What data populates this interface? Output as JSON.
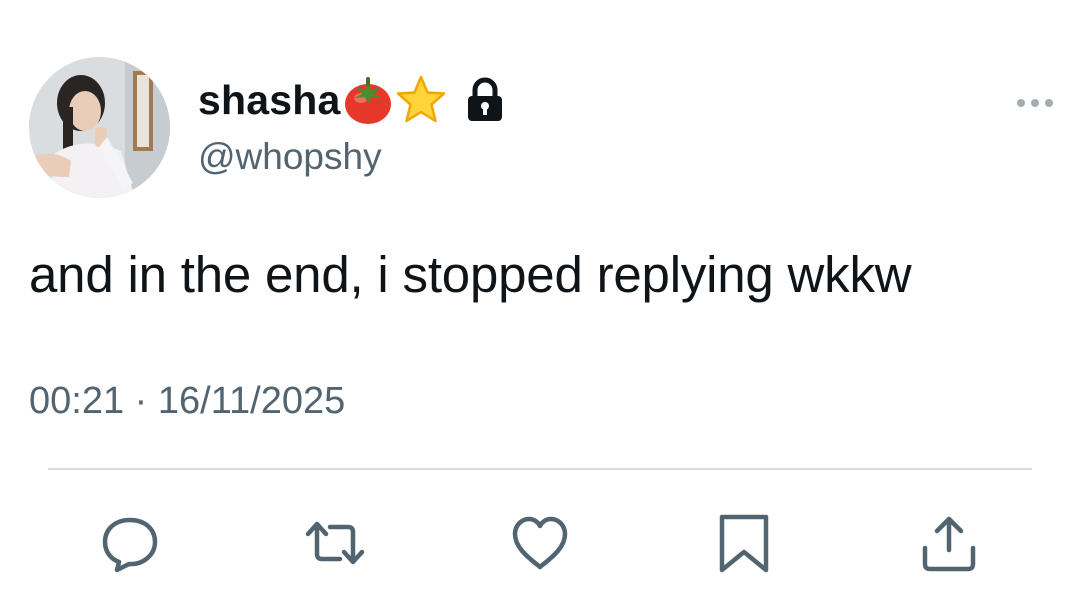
{
  "user": {
    "display_name": "shasha",
    "name_emojis": [
      "tomato-emoji",
      "star-emoji"
    ],
    "protected": true,
    "handle": "@whopshy"
  },
  "tweet": {
    "text": "and in the end, i stopped replying wkkw",
    "timestamp": "00:21 · 16/11/2025"
  },
  "actions": [
    "reply",
    "retweet",
    "like",
    "bookmark",
    "share"
  ],
  "colors": {
    "text": "#0f1419",
    "secondary": "#536471",
    "divider": "#d7dbde"
  }
}
